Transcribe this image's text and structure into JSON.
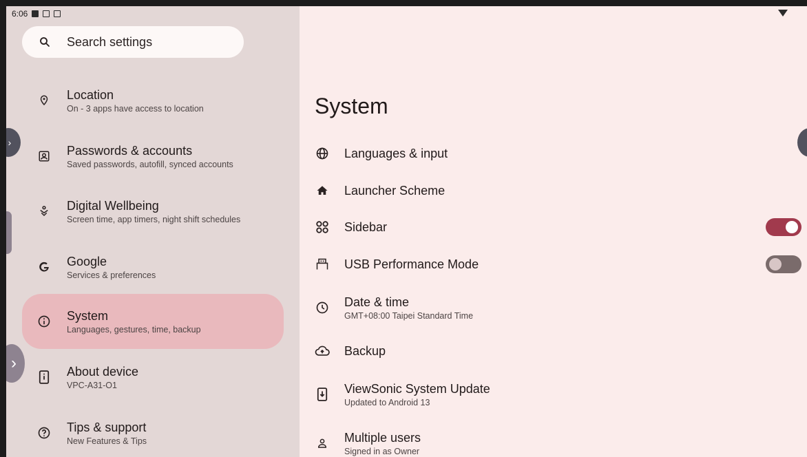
{
  "status_bar": {
    "time": "6:06"
  },
  "search": {
    "placeholder": "Search settings"
  },
  "nav": {
    "items": [
      {
        "title": "Location",
        "subtitle": "On - 3 apps have access to location",
        "icon": "location-pin-icon"
      },
      {
        "title": "Passwords & accounts",
        "subtitle": "Saved passwords, autofill, synced accounts",
        "icon": "account-box-icon"
      },
      {
        "title": "Digital Wellbeing",
        "subtitle": "Screen time, app timers, night shift schedules",
        "icon": "wellbeing-icon"
      },
      {
        "title": "Google",
        "subtitle": "Services & preferences",
        "icon": "google-icon"
      },
      {
        "title": "System",
        "subtitle": "Languages, gestures, time, backup",
        "icon": "info-icon",
        "selected": true
      },
      {
        "title": "About device",
        "subtitle": "VPC-A31-O1",
        "icon": "device-info-icon"
      },
      {
        "title": "Tips & support",
        "subtitle": "New Features & Tips",
        "icon": "help-icon"
      }
    ]
  },
  "main": {
    "title": "System",
    "rows": [
      {
        "title": "Languages & input",
        "icon": "globe-icon"
      },
      {
        "title": "Launcher Scheme",
        "icon": "home-icon"
      },
      {
        "title": "Sidebar",
        "icon": "sidebar-icon",
        "toggle": true
      },
      {
        "title": "USB Performance Mode",
        "icon": "usb-icon",
        "toggle": false
      },
      {
        "title": "Date & time",
        "subtitle": "GMT+08:00 Taipei Standard Time",
        "icon": "clock-icon"
      },
      {
        "title": "Backup",
        "icon": "cloud-backup-icon"
      },
      {
        "title": "ViewSonic System Update",
        "subtitle": "Updated to Android 13",
        "icon": "system-update-icon"
      },
      {
        "title": "Multiple users",
        "subtitle": "Signed in as Owner",
        "icon": "person-icon"
      }
    ]
  },
  "colors": {
    "accent": "#a13a4d",
    "selected_bg": "#e9b9bd",
    "left_bg": "#e3d7d6",
    "right_bg": "#fbeceb"
  }
}
